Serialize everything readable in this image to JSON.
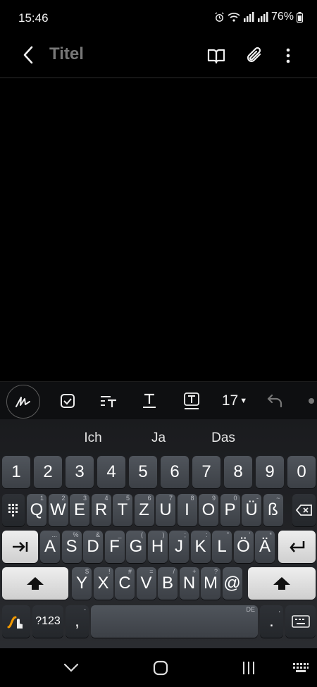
{
  "status": {
    "time": "15:46",
    "battery": "76%"
  },
  "app": {
    "title_placeholder": "Titel"
  },
  "toolbar": {
    "font_size": "17"
  },
  "suggestions": [
    "Ich",
    "Ja",
    "Das"
  ],
  "keyboard": {
    "number_row": [
      {
        "label": "1"
      },
      {
        "label": "2"
      },
      {
        "label": "3"
      },
      {
        "label": "4"
      },
      {
        "label": "5"
      },
      {
        "label": "6"
      },
      {
        "label": "7"
      },
      {
        "label": "8"
      },
      {
        "label": "9"
      },
      {
        "label": "0"
      }
    ],
    "row1": [
      {
        "label": "Q",
        "hint": "1"
      },
      {
        "label": "W",
        "hint": "2"
      },
      {
        "label": "E",
        "hint": "3"
      },
      {
        "label": "R",
        "hint": "4"
      },
      {
        "label": "T",
        "hint": "5"
      },
      {
        "label": "Z",
        "hint": "6"
      },
      {
        "label": "U",
        "hint": "7"
      },
      {
        "label": "I",
        "hint": "8"
      },
      {
        "label": "O",
        "hint": "9"
      },
      {
        "label": "P",
        "hint": "0"
      },
      {
        "label": "Ü",
        "hint": "-"
      },
      {
        "label": "ß",
        "hint": "~"
      }
    ],
    "row2": [
      {
        "label": "A",
        "hint": "..."
      },
      {
        "label": "S",
        "hint": "%"
      },
      {
        "label": "D",
        "hint": "&"
      },
      {
        "label": "F",
        "hint": "_"
      },
      {
        "label": "G",
        "hint": "("
      },
      {
        "label": "H",
        "hint": ")"
      },
      {
        "label": "J",
        "hint": ";"
      },
      {
        "label": "K",
        "hint": ":"
      },
      {
        "label": "L",
        "hint": "\""
      },
      {
        "label": "Ö",
        "hint": "'"
      },
      {
        "label": "Ä",
        "hint": "*"
      }
    ],
    "row3": [
      {
        "label": "Y",
        "hint": "$"
      },
      {
        "label": "X",
        "hint": "!"
      },
      {
        "label": "C",
        "hint": "#"
      },
      {
        "label": "V",
        "hint": "="
      },
      {
        "label": "B",
        "hint": "/"
      },
      {
        "label": "N",
        "hint": "+"
      },
      {
        "label": "M",
        "hint": "?"
      },
      {
        "label": "@",
        "hint": ""
      }
    ],
    "symbols_label": "?123",
    "comma": ",",
    "comma_hint": "-",
    "space_lang": "DE",
    "period": ".",
    "period_hint": ","
  },
  "colors": {
    "background": "#000000",
    "key": "#474b51",
    "accent": "#f29900"
  }
}
